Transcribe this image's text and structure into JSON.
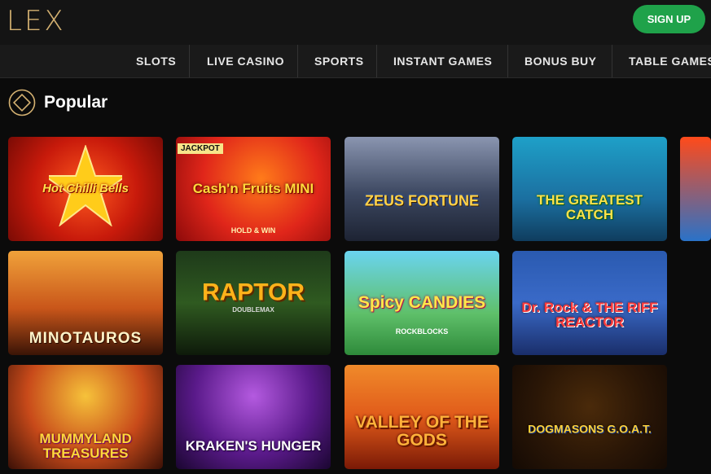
{
  "header": {
    "logo": "LEX",
    "signup_label": "SIGN UP"
  },
  "nav": {
    "items": [
      "SLOTS",
      "LIVE CASINO",
      "SPORTS",
      "INSTANT GAMES",
      "BONUS BUY",
      "TABLE GAMES"
    ]
  },
  "section": {
    "title": "Popular"
  },
  "colors": {
    "brand_gold": "#d4b171",
    "signup_green": "#1fa24a"
  },
  "games": [
    {
      "title": "Hot Chilli Bells"
    },
    {
      "title": "Cash'n Fruits MINI",
      "subtitle": "HOLD & WIN",
      "badge": "JACKPOT"
    },
    {
      "title": "ZEUS FORTUNE"
    },
    {
      "title": "THE GREATEST CATCH"
    },
    {
      "title": "MINOTAUROS"
    },
    {
      "title": "RAPTOR",
      "subtitle": "DOUBLEMAX"
    },
    {
      "title": "Spicy CANDIES",
      "subtitle": "ROCKBLOCKS"
    },
    {
      "title": "Dr. Rock & THE RIFF REACTOR"
    },
    {
      "title": "MUMMYLAND TREASURES"
    },
    {
      "title": "KRAKEN'S HUNGER"
    },
    {
      "title": "VALLEY OF THE GODS"
    },
    {
      "title": "DOGMASONS G.O.A.T."
    }
  ]
}
